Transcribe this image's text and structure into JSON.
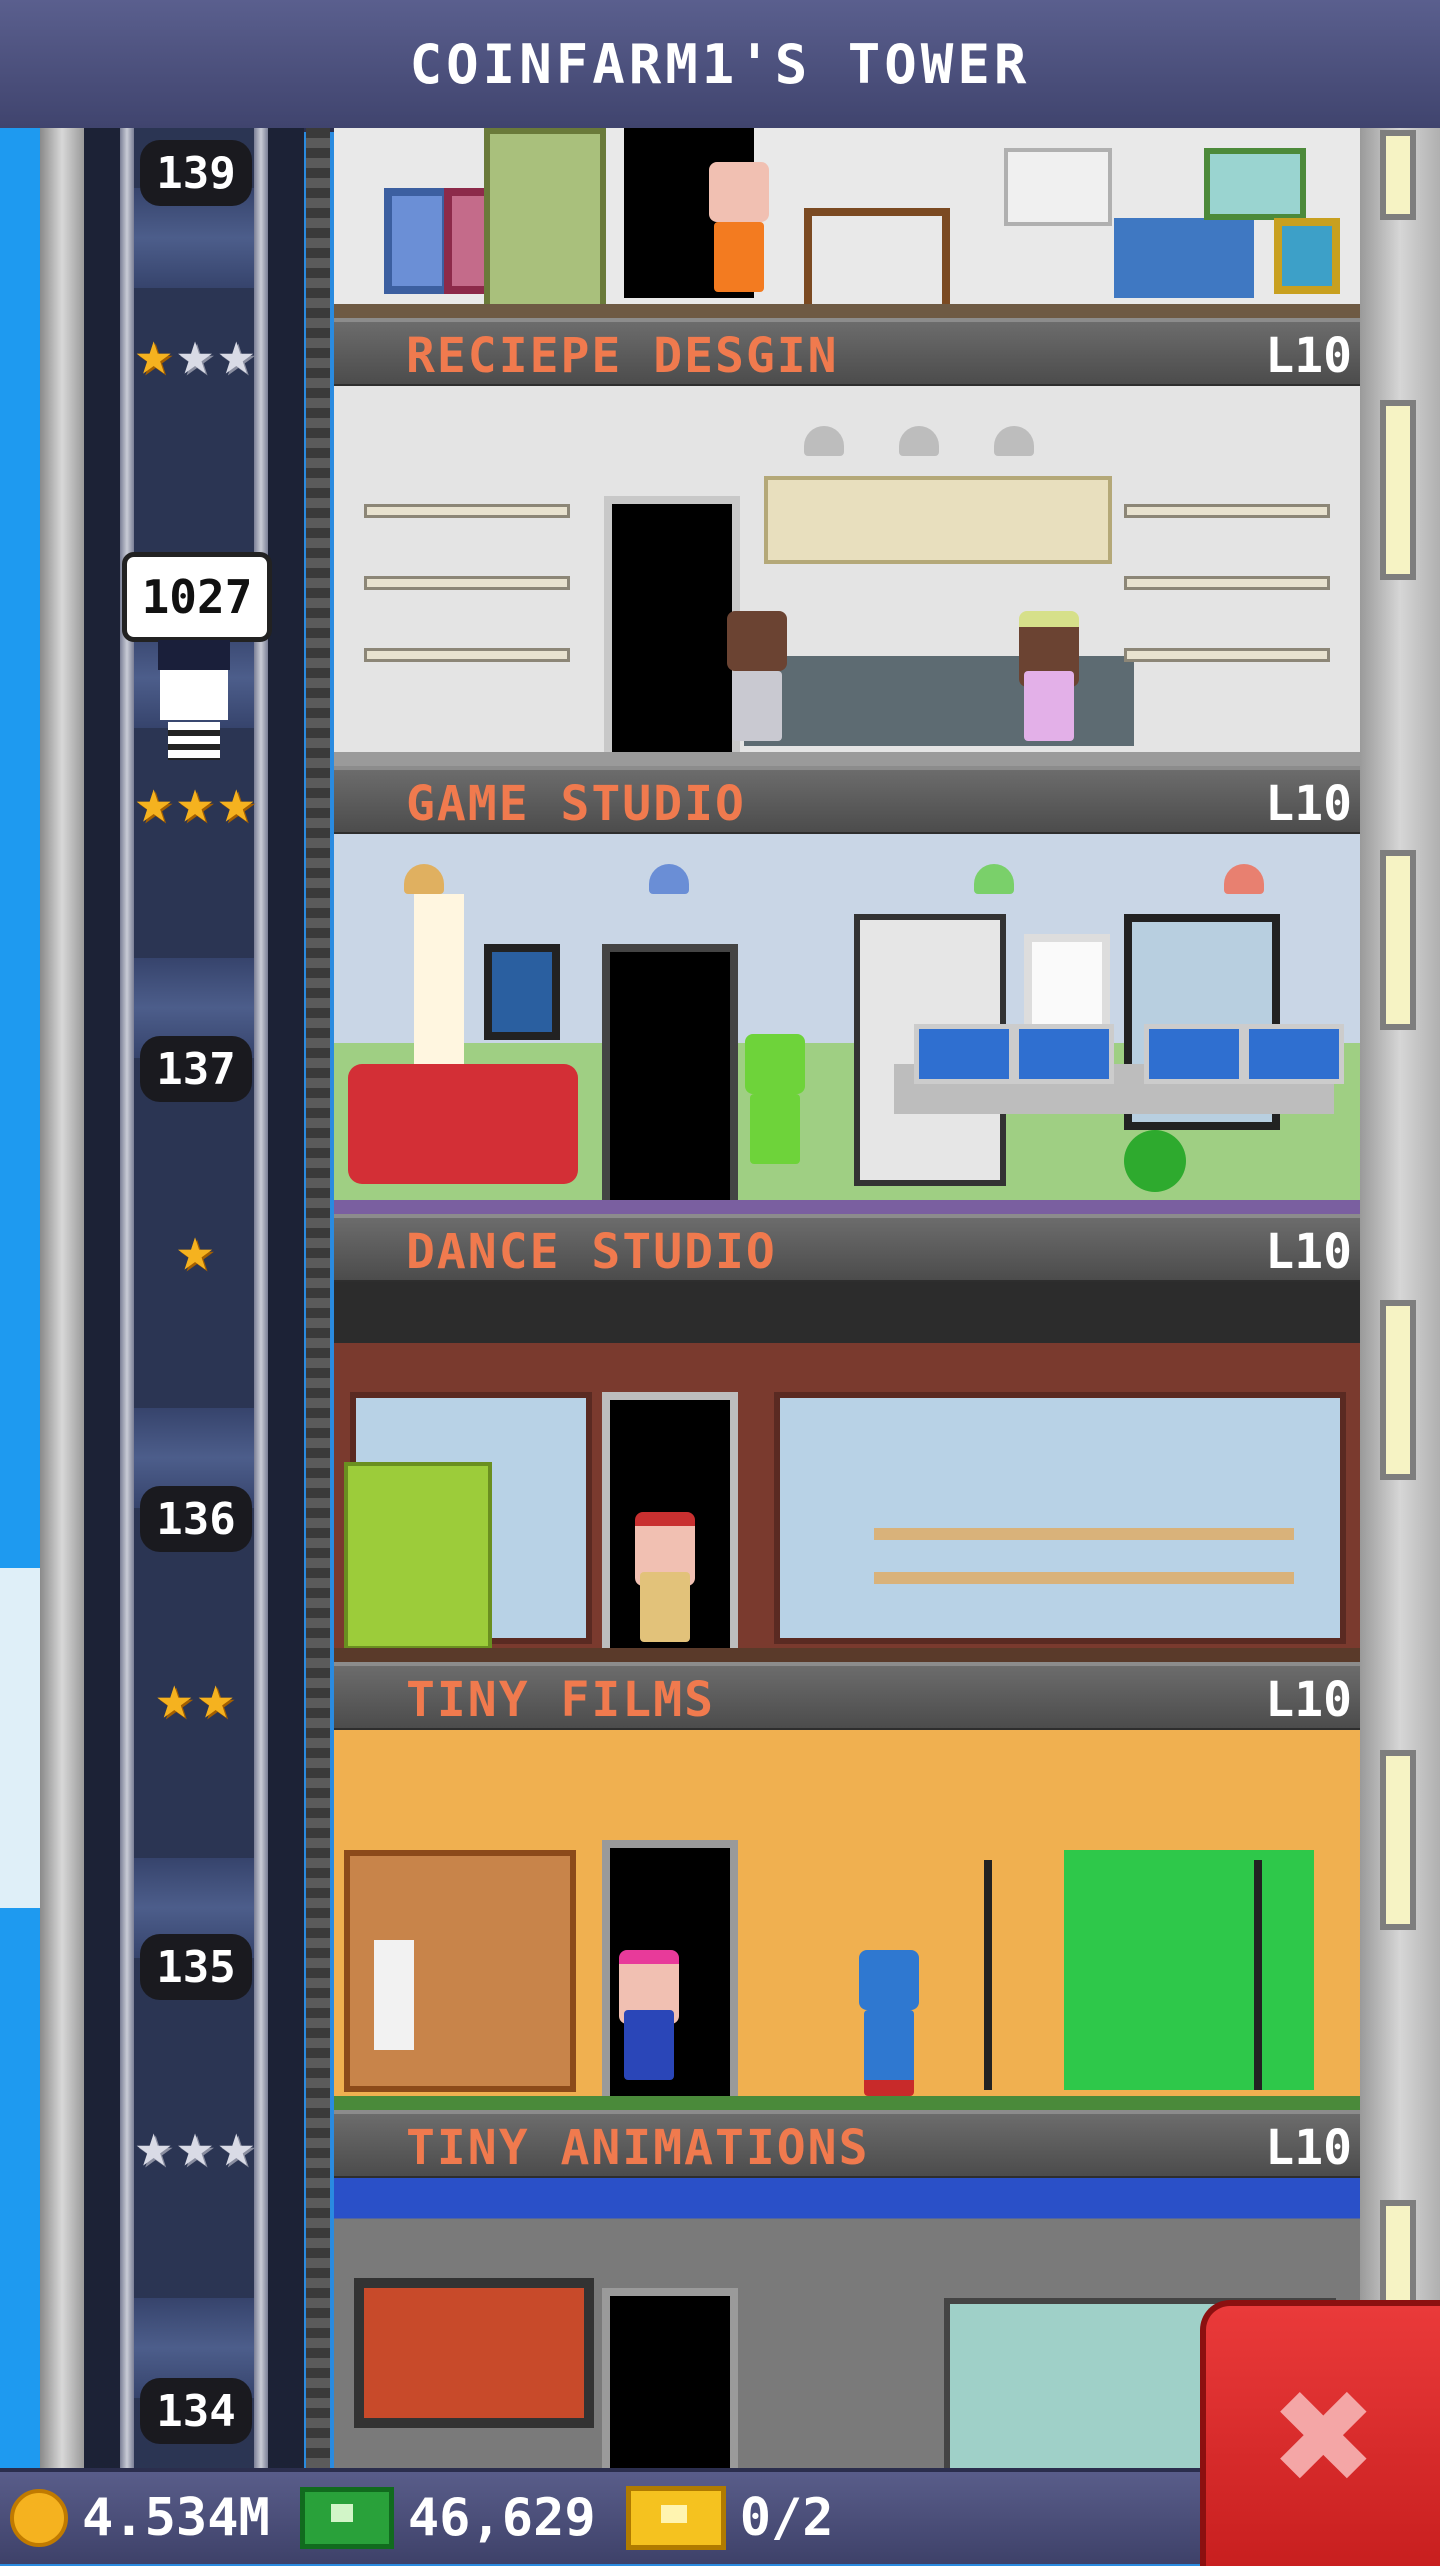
{
  "header": {
    "title": "COINFARM1'S TOWER"
  },
  "elevator": {
    "rider_bubble": "1027",
    "floor_numbers": [
      "139",
      "137",
      "136",
      "135",
      "134"
    ]
  },
  "floors": [
    {
      "name": "RECIEPE DESGIN",
      "level": "L10",
      "stars": [
        "gold",
        "silver",
        "silver"
      ]
    },
    {
      "name": "GAME STUDIO",
      "level": "L10",
      "stars": [
        "gold",
        "gold",
        "gold"
      ]
    },
    {
      "name": "DANCE STUDIO",
      "level": "L10",
      "stars": [
        "gold"
      ]
    },
    {
      "name": "TINY FILMS",
      "level": "L10",
      "stars": [
        "gold",
        "gold"
      ]
    },
    {
      "name": "TINY ANIMATIONS",
      "level": "L10",
      "stars": [
        "silver",
        "silver",
        "silver"
      ]
    }
  ],
  "status": {
    "coins": "4.534M",
    "bux": "46,629",
    "tickets": "0/2"
  },
  "icons": {
    "coin": "coin-icon",
    "cash": "cash-icon",
    "ticket": "golden-ticket-icon",
    "close": "close-icon",
    "star": "star-icon"
  },
  "colors": {
    "label_text": "#f07a4e",
    "gold_star": "#f5b21f",
    "close_button": "#d62828"
  }
}
